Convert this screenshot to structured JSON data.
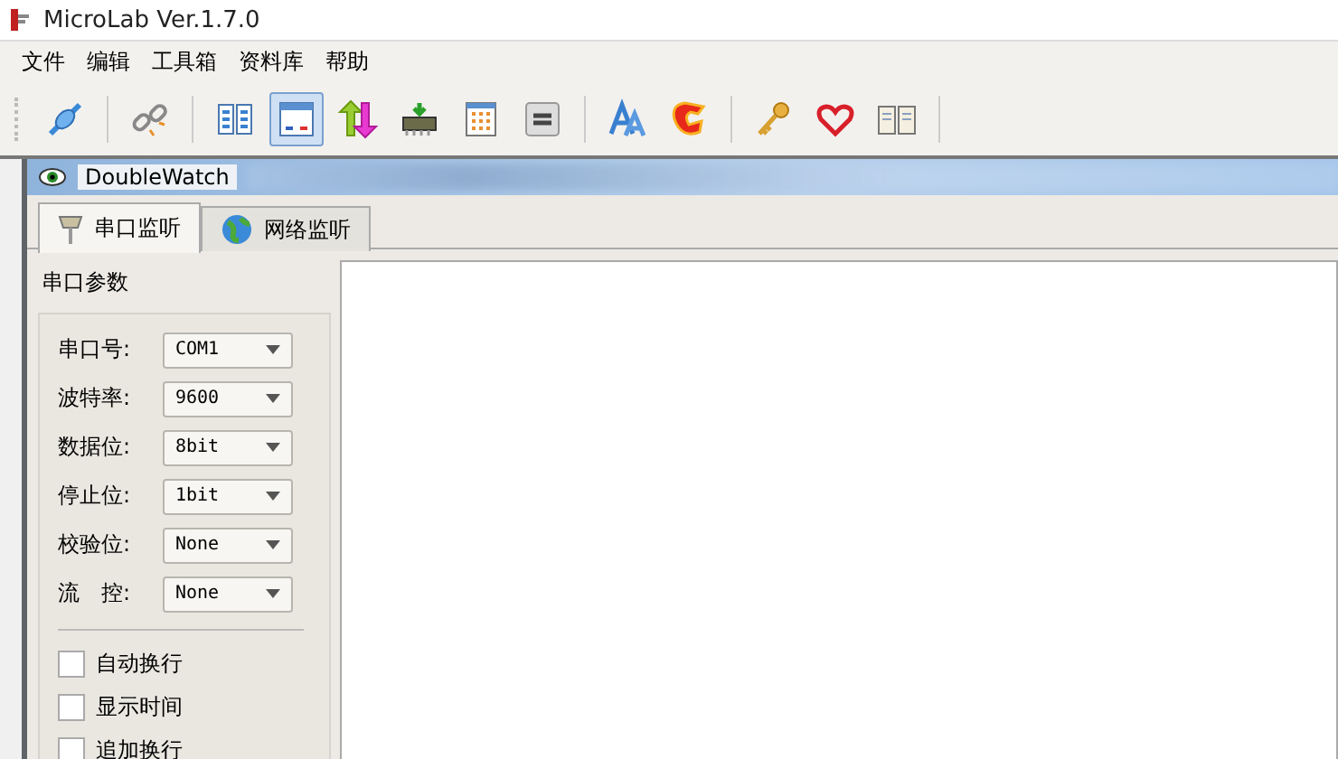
{
  "window": {
    "title": "MicroLab Ver.1.7.0"
  },
  "menu": [
    "文件",
    "编辑",
    "工具箱",
    "资料库",
    "帮助"
  ],
  "toolbar": {
    "groups": [
      [
        {
          "selected": false
        }
      ],
      [
        {
          "selected": false
        }
      ],
      [
        {
          "selected": false
        },
        {
          "selected": true
        },
        {
          "selected": false
        },
        {
          "selected": false
        },
        {
          "selected": false
        },
        {
          "selected": false
        }
      ],
      [
        {
          "selected": false
        },
        {
          "selected": false
        }
      ],
      [
        {
          "selected": false
        },
        {
          "selected": false
        },
        {
          "selected": false
        }
      ]
    ]
  },
  "inner_window": {
    "title": "DoubleWatch"
  },
  "tabs": [
    {
      "label": "串口监听",
      "selected": true
    },
    {
      "label": "网络监听",
      "selected": false
    }
  ],
  "serial_panel": {
    "title": "串口参数",
    "fields": [
      {
        "label": "串口号:",
        "value": "COM1"
      },
      {
        "label": "波特率:",
        "value": "9600"
      },
      {
        "label": "数据位:",
        "value": "8bit"
      },
      {
        "label": "停止位:",
        "value": "1bit"
      },
      {
        "label": "校验位:",
        "value": "None"
      },
      {
        "label": "流　控:",
        "value": "None"
      }
    ],
    "options": [
      {
        "label": "自动换行",
        "checked": false
      },
      {
        "label": "显示时间",
        "checked": false
      },
      {
        "label": "追加换行",
        "checked": false
      }
    ]
  }
}
